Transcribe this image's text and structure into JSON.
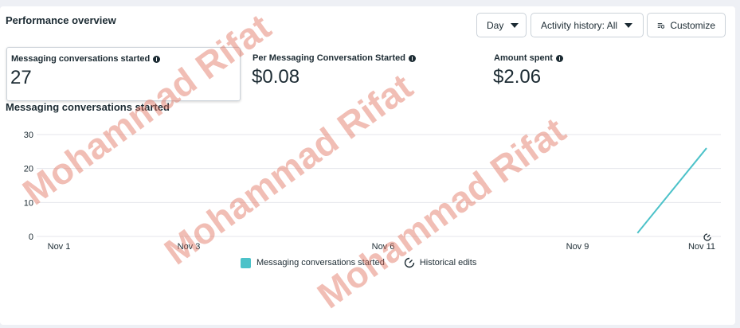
{
  "header": {
    "title": "Performance overview",
    "day_label": "Day",
    "activity_label": "Activity history: All",
    "customize_label": "Customize"
  },
  "metrics": [
    {
      "label": "Messaging conversations started",
      "value": "27"
    },
    {
      "label": "Per Messaging Conversation Started",
      "value": "$0.08"
    },
    {
      "label": "Amount spent",
      "value": "$2.06"
    }
  ],
  "chart_title": "Messaging conversations started",
  "chart_data": {
    "type": "line",
    "x_tick_labels": [
      "Nov 1",
      "Nov 3",
      "Nov 6",
      "Nov 9",
      "Nov 11"
    ],
    "y_ticks": [
      0,
      10,
      20,
      30
    ],
    "ylim": [
      0,
      30
    ],
    "grid": true,
    "series": [
      {
        "name": "Messaging conversations started",
        "color": "#4cc2c9",
        "points": [
          {
            "x": "Nov 10",
            "y": 1
          },
          {
            "x": "Nov 11",
            "y": 26
          }
        ]
      }
    ],
    "legend": [
      "Messaging conversations started",
      "Historical edits"
    ],
    "legend_position": "bottom"
  },
  "watermark": "Mohammad Rifat",
  "icons": {
    "dropdown": "chevron-down-icon",
    "customize": "customize-icon",
    "info": "info-icon",
    "historical": "historical-edits-icon"
  }
}
